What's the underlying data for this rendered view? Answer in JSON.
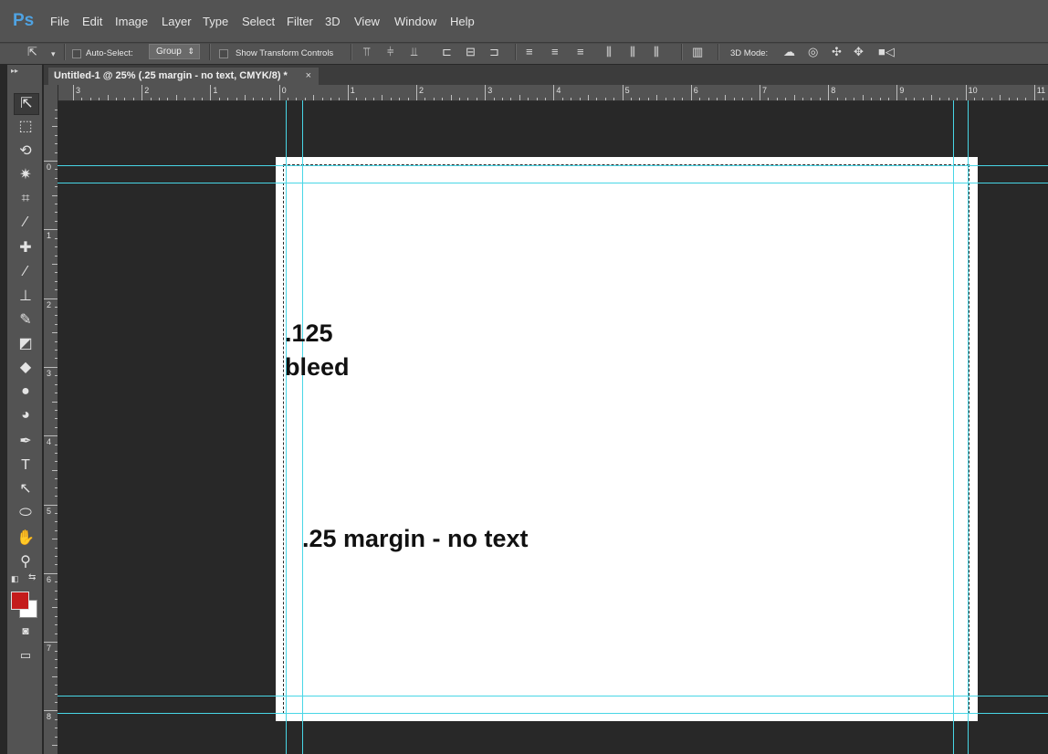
{
  "app": {
    "logo": "Ps"
  },
  "menu": [
    "File",
    "Edit",
    "Image",
    "Layer",
    "Type",
    "Select",
    "Filter",
    "3D",
    "View",
    "Window",
    "Help"
  ],
  "options": {
    "auto_select_label": "Auto-Select:",
    "auto_select_checked": false,
    "group_select": "Group",
    "show_transform_label": "Show Transform Controls",
    "show_transform_checked": false,
    "mode_label": "3D Mode:"
  },
  "document": {
    "tab_title": "Untitled-1 @ 25% (.25 margin - no text, CMYK/8) *",
    "close_glyph": "×",
    "text_bleed_line1": ".125",
    "text_bleed_line2": "bleed",
    "text_margin": ".25 margin - no text",
    "background": "#ffffff"
  },
  "rulers": {
    "horizontal_labels": [
      "3",
      "2",
      "1",
      "0",
      "1",
      "2",
      "3",
      "4",
      "5",
      "6",
      "7",
      "8",
      "9",
      "10",
      "11"
    ],
    "vertical_labels": [
      "0",
      "1",
      "2",
      "3",
      "4",
      "5",
      "6",
      "7",
      "8"
    ]
  },
  "tools": [
    "move-tool-icon",
    "marquee-tool-icon",
    "lasso-tool-icon",
    "magic-wand-tool-icon",
    "crop-tool-icon",
    "eyedropper-tool-icon",
    "healing-brush-tool-icon",
    "brush-tool-icon",
    "clone-stamp-tool-icon",
    "history-brush-tool-icon",
    "eraser-tool-icon",
    "paint-bucket-tool-icon",
    "blur-tool-icon",
    "dodge-tool-icon",
    "pen-tool-icon",
    "type-tool-icon",
    "path-selection-tool-icon",
    "ellipse-tool-icon",
    "hand-tool-icon",
    "zoom-tool-icon"
  ],
  "colors": {
    "foreground": "#c41b1b",
    "background": "#ffffff",
    "guide": "#48d6e6",
    "logo": "#4fa3e3"
  }
}
